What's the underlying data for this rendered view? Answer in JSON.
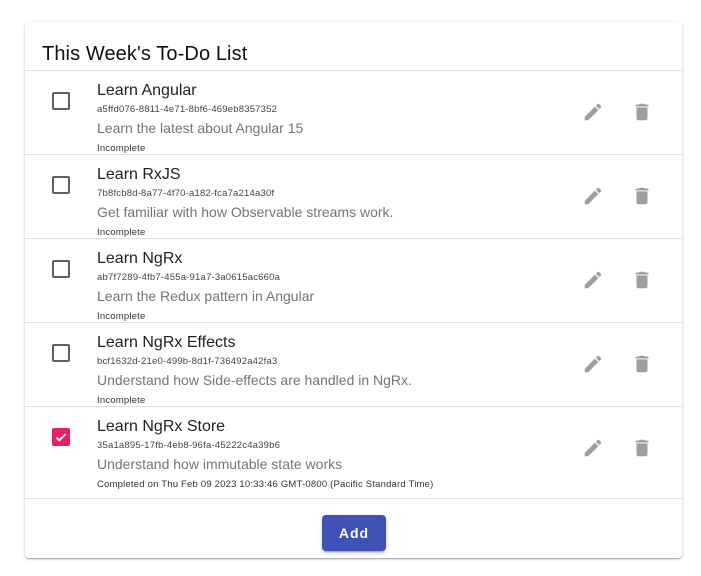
{
  "header": {
    "title": "This Week's To-Do List"
  },
  "todos": [
    {
      "title": "Learn Angular",
      "id": "a5ffd076-8811-4e71-8bf6-469eb8357352",
      "description": "Learn the latest about Angular 15",
      "status": "Incomplete",
      "checked": false
    },
    {
      "title": "Learn RxJS",
      "id": "7b8fcb8d-8a77-4f70-a182-fca7a214a30f",
      "description": "Get familiar with how Observable streams work.",
      "status": "Incomplete",
      "checked": false
    },
    {
      "title": "Learn NgRx",
      "id": "ab7f7289-4fb7-455a-91a7-3a0615ac660a",
      "description": "Learn the Redux pattern in Angular",
      "status": "Incomplete",
      "checked": false
    },
    {
      "title": "Learn NgRx Effects",
      "id": "bcf1632d-21e0-499b-8d1f-736492a42fa3",
      "description": "Understand how Side-effects are handled in NgRx.",
      "status": "Incomplete",
      "checked": false
    },
    {
      "title": "Learn NgRx Store",
      "id": "35a1a895-17fb-4eb8-96fa-45222c4a39b6",
      "description": "Understand how immutable state works",
      "status": "Completed on Thu Feb 09 2023 10:33:46 GMT-0800 (Pacific Standard Time)",
      "checked": true
    }
  ],
  "icons": {
    "checkbox": "checkbox-icon",
    "edit": "pencil-icon",
    "delete": "trash-icon"
  },
  "colors": {
    "accent": "#e91e63",
    "primary": "#3f51b5",
    "icon": "#9e9e9e"
  },
  "footer": {
    "add_label": "Add"
  }
}
